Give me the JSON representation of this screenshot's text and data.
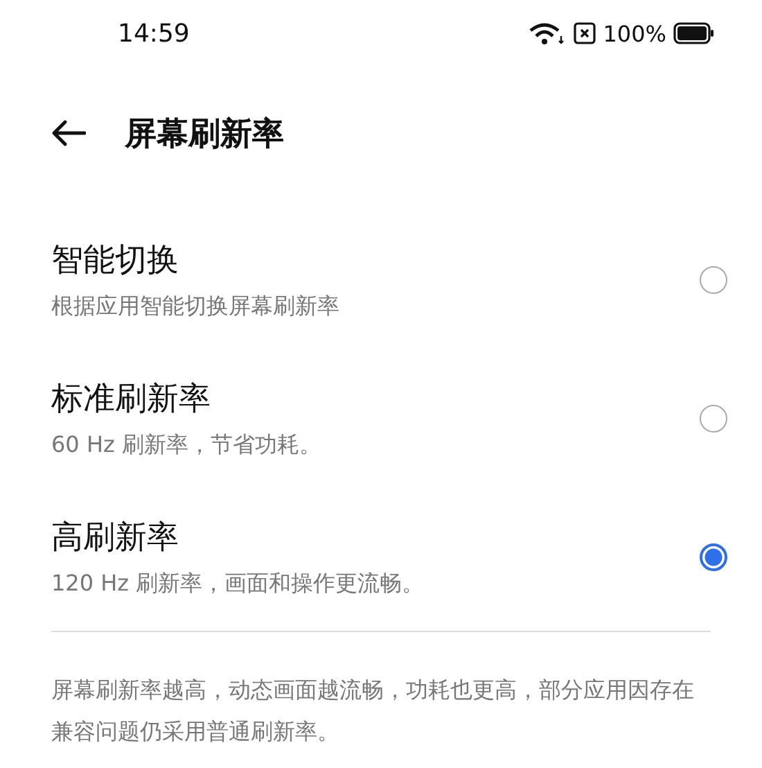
{
  "status_bar": {
    "time": "14:59",
    "battery": "100%"
  },
  "header": {
    "title": "屏幕刷新率"
  },
  "options": [
    {
      "title": "智能切换",
      "subtitle": "根据应用智能切换屏幕刷新率",
      "selected": false
    },
    {
      "title": "标准刷新率",
      "subtitle": "60 Hz 刷新率，节省功耗。",
      "selected": false
    },
    {
      "title": "高刷新率",
      "subtitle": "120 Hz 刷新率，画面和操作更流畅。",
      "selected": true
    }
  ],
  "footnote": "屏幕刷新率越高，动态画面越流畅，功耗也更高，部分应用因存在兼容问题仍采用普通刷新率。"
}
